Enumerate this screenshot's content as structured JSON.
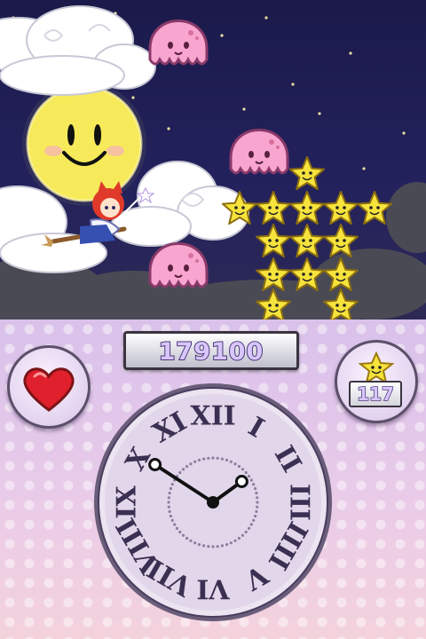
{
  "hud": {
    "score": "179100",
    "star_count": "117"
  },
  "clock": {
    "numerals": [
      "XII",
      "I",
      "II",
      "III",
      "IIII",
      "V",
      "VI",
      "VII",
      "VIII",
      "IX",
      "X",
      "XI"
    ],
    "hour_hand_hours": 10.1,
    "minute_hand_minutes": 9
  },
  "colors": {
    "sky": "#23215c",
    "lower_screen": "#e9cbe9",
    "octopus": "#f8a6cf",
    "star": "#f6e33c",
    "heart": "#e0202c",
    "clock_face": "#e6dced",
    "numerals": "#3b2f52"
  },
  "icons": [
    "moon-face-icon",
    "octopus-enemy-icon",
    "smiling-star-icon",
    "heart-icon",
    "witch-girl-sprite"
  ]
}
